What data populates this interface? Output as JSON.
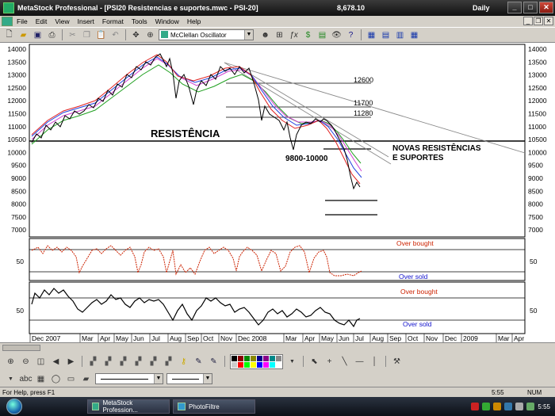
{
  "window": {
    "title": "MetaStock Professional - [PSI20  Resistencias e suportes.mwc - PSI-20]",
    "last_price": "8,678.10",
    "period": "Daily",
    "minimize": "_",
    "maximize": "□",
    "close": "✕"
  },
  "menu": [
    "File",
    "Edit",
    "View",
    "Insert",
    "Format",
    "Tools",
    "Window",
    "Help"
  ],
  "toolbar": {
    "indicator_select": "McClellan Oscillator"
  },
  "chart": {
    "price_axis_ticks": [
      "14000",
      "13500",
      "13000",
      "12500",
      "12000",
      "11500",
      "11000",
      "10500",
      "10000",
      "9500",
      "9000",
      "8500",
      "8000",
      "7500",
      "7000"
    ],
    "panel_tick": "50",
    "months": [
      "Dec 2007",
      "Mar",
      "Apr",
      "May",
      "Jun",
      "Jul",
      "Aug",
      "Sep",
      "Oct",
      "Nov",
      "Dec 2008",
      "Mar",
      "Apr",
      "May",
      "Jun",
      "Jul",
      "Aug",
      "Sep",
      "Oct",
      "Nov",
      "Dec",
      "2009",
      "Mar",
      "Apr"
    ],
    "labels": {
      "resistencia": "RESISTÊNCIA",
      "level_12600": "12600",
      "level_11700": "11700",
      "level_11280": "11280",
      "zone_9800": "9800-10000",
      "novas_1": "NOVAS RESISTÊNCIAS",
      "novas_2": "E SUPORTES"
    },
    "osc1": {
      "overbought": "Over bought",
      "oversold": "Over sold"
    },
    "osc2": {
      "overbought": "Over bought",
      "oversold": "Over sold"
    },
    "colors": {
      "overbought": "#cc2200",
      "oversold": "#1010cc",
      "ma_red": "#e02020",
      "ma_blue": "#2040e0",
      "ma_magenta": "#d040d0",
      "ma_green": "#20a020"
    }
  },
  "status": {
    "help": "For Help, press F1",
    "time": "5:55",
    "num": "NUM"
  },
  "taskbar": {
    "task1": "MetaStock Profession...",
    "task2": "PhotoFiltre",
    "clock": "5:55"
  }
}
